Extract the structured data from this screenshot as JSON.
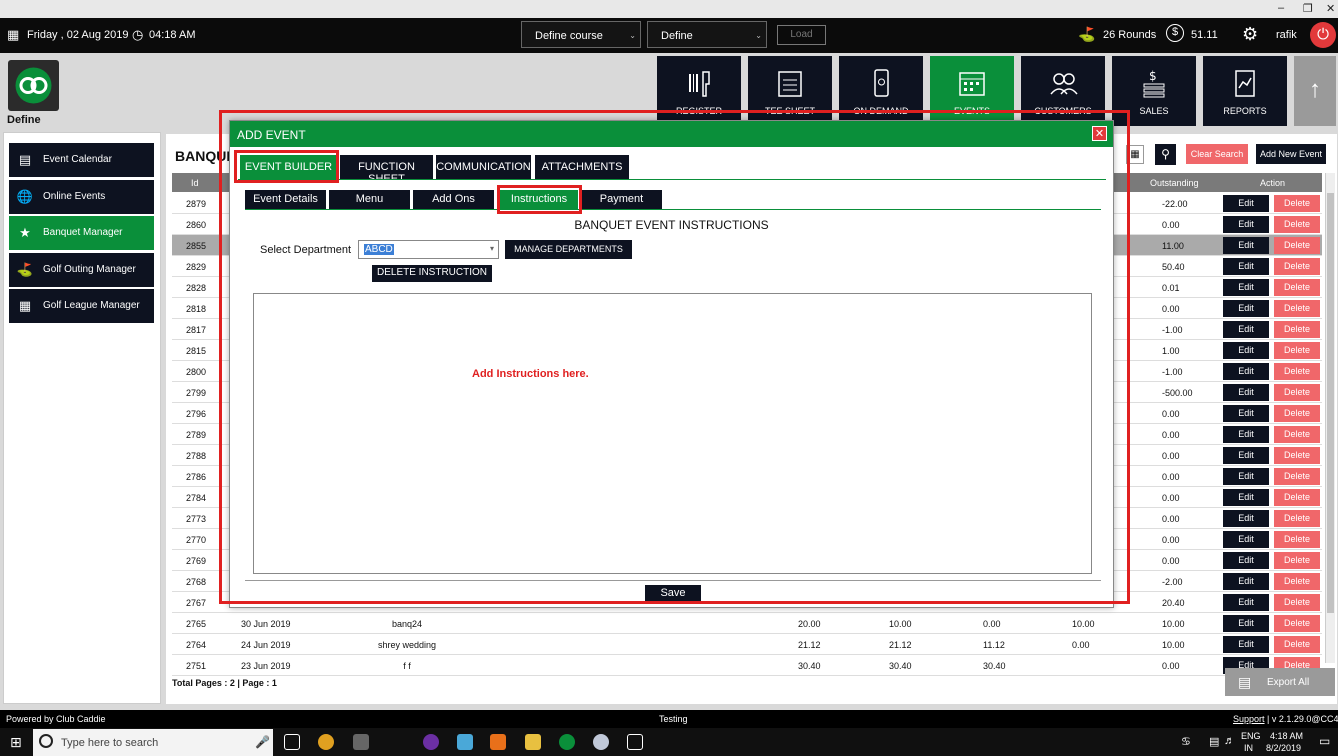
{
  "topbar": {
    "date": "Friday ,  02 Aug 2019",
    "time": "04:18 AM",
    "course_select": "Define course",
    "define_select": "Define",
    "load": "Load",
    "rounds": "26 Rounds",
    "balance": "51.11",
    "user": "rafik"
  },
  "logo_label": "Define",
  "tiles": [
    {
      "label": "REGISTER"
    },
    {
      "label": "TEE SHEET"
    },
    {
      "label": "ON DEMAND"
    },
    {
      "label": "EVENTS"
    },
    {
      "label": "CUSTOMERS"
    },
    {
      "label": "SALES"
    },
    {
      "label": "REPORTS"
    }
  ],
  "sidebar": {
    "items": [
      {
        "label": "Event Calendar"
      },
      {
        "label": "Online Events"
      },
      {
        "label": "Banquet Manager"
      },
      {
        "label": "Golf Outing Manager"
      },
      {
        "label": "Golf League Manager"
      }
    ]
  },
  "main": {
    "title": "BANQUET",
    "clear_search": "Clear Search",
    "add_new_event": "Add New Event",
    "headers": {
      "id": "Id",
      "outstanding": "Outstanding",
      "action": "Action"
    },
    "rows": [
      {
        "id": "2879",
        "outstanding": "-22.00"
      },
      {
        "id": "2860",
        "outstanding": "0.00"
      },
      {
        "id": "2855",
        "outstanding": "11.00"
      },
      {
        "id": "2829",
        "outstanding": "50.40"
      },
      {
        "id": "2828",
        "outstanding": "0.01"
      },
      {
        "id": "2818",
        "outstanding": "0.00"
      },
      {
        "id": "2817",
        "outstanding": "-1.00"
      },
      {
        "id": "2815",
        "outstanding": "1.00"
      },
      {
        "id": "2800",
        "outstanding": "-1.00"
      },
      {
        "id": "2799",
        "outstanding": "-500.00"
      },
      {
        "id": "2796",
        "outstanding": "0.00"
      },
      {
        "id": "2789",
        "outstanding": "0.00"
      },
      {
        "id": "2788",
        "outstanding": "0.00"
      },
      {
        "id": "2786",
        "outstanding": "0.00"
      },
      {
        "id": "2784",
        "outstanding": "0.00"
      },
      {
        "id": "2773",
        "outstanding": "0.00"
      },
      {
        "id": "2770",
        "outstanding": "0.00"
      },
      {
        "id": "2769",
        "outstanding": "0.00"
      },
      {
        "id": "2768",
        "outstanding": "-2.00"
      },
      {
        "id": "2767",
        "outstanding": "20.40"
      },
      {
        "id": "2765",
        "date": "30 Jun 2019",
        "name": "banq24",
        "v1": "20.00",
        "v2": "10.00",
        "v3": "0.00",
        "v4": "10.00",
        "outstanding": "10.00"
      },
      {
        "id": "2764",
        "date": "24 Jun 2019",
        "name": "shrey wedding",
        "v1": "21.12",
        "v2": "21.12",
        "v3": "11.12",
        "v4": "0.00",
        "outstanding": "10.00"
      },
      {
        "id": "2751",
        "date": "23 Jun 2019",
        "name": "f f",
        "v1": "30.40",
        "v2": "30.40",
        "v3": "30.40",
        "v4": "",
        "outstanding": "0.00"
      }
    ],
    "edit_label": "Edit",
    "delete_label": "Delete",
    "pages": "Total Pages : 2 | Page : 1",
    "export": "Export All"
  },
  "modal": {
    "title": "ADD EVENT",
    "tabs": [
      {
        "label": "EVENT BUILDER"
      },
      {
        "label": "FUNCTION SHEET"
      },
      {
        "label": "COMMUNICATION"
      },
      {
        "label": "ATTACHMENTS"
      }
    ],
    "subtabs": [
      {
        "label": "Event Details"
      },
      {
        "label": "Menu"
      },
      {
        "label": "Add Ons"
      },
      {
        "label": "Instructions"
      },
      {
        "label": "Payment"
      }
    ],
    "section_title": "BANQUET EVENT INSTRUCTIONS",
    "department_label": "Select Department",
    "department_value": "ABCD",
    "manage_departments": "MANAGE DEPARTMENTS",
    "delete_instruction": "DELETE INSTRUCTION",
    "instructions_placeholder": "Add Instructions here.",
    "save": "Save"
  },
  "footer": {
    "powered": "Powered by Club Caddie",
    "env": "Testing",
    "support": "Support",
    "version": "| v 2.1.29.0@CC4"
  },
  "taskbar": {
    "search_placeholder": "Type here to search",
    "lang": "ENG",
    "region": "IN",
    "clock_time": "4:18 AM",
    "clock_date": "8/2/2019"
  },
  "colors": {
    "accent": "#0a8f3a",
    "dark": "#0d1220",
    "danger": "#f0676a",
    "highlight": "#e02020"
  }
}
